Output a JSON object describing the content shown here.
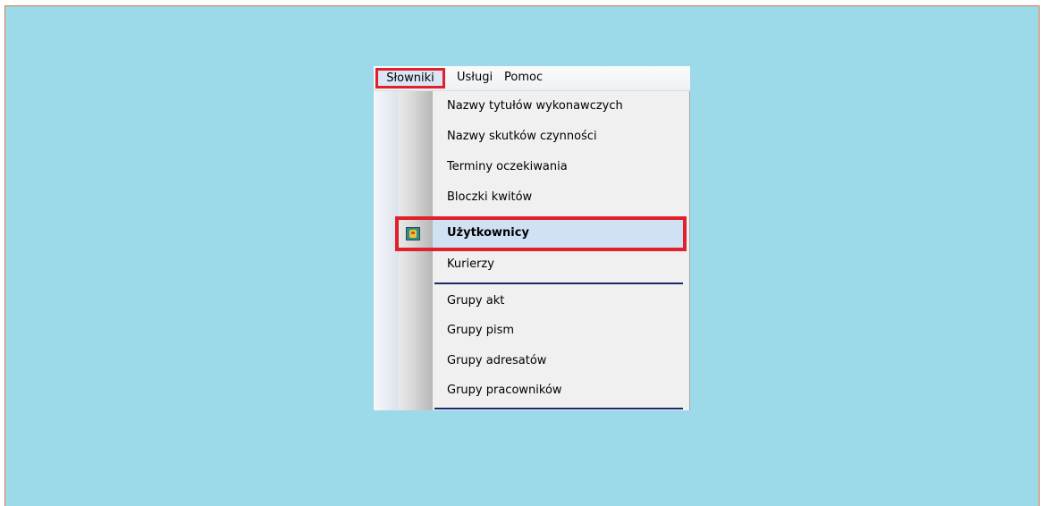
{
  "menubar": {
    "items": [
      {
        "label": "Słowniki"
      },
      {
        "label": "Usługi"
      },
      {
        "label": "Pomoc"
      }
    ]
  },
  "dropdown": {
    "items": [
      {
        "label": "Nazwy tytułów  wykonawczych"
      },
      {
        "label": "Nazwy skutków czynności"
      },
      {
        "label": "Terminy oczekiwania"
      },
      {
        "label": "Bloczki kwitów"
      },
      {
        "label": "Użytkownicy",
        "icon": "users-icon",
        "selected": true
      },
      {
        "label": "Kurierzy"
      },
      {
        "label": "Grupy akt"
      },
      {
        "label": "Grupy pism"
      },
      {
        "label": "Grupy adresatów"
      },
      {
        "label": "Grupy pracowników"
      }
    ]
  },
  "colors": {
    "background": "#9cd9e9",
    "highlight_border": "#e0202a",
    "selection": "#cfe1f3",
    "separator": "#1a2a6c"
  }
}
